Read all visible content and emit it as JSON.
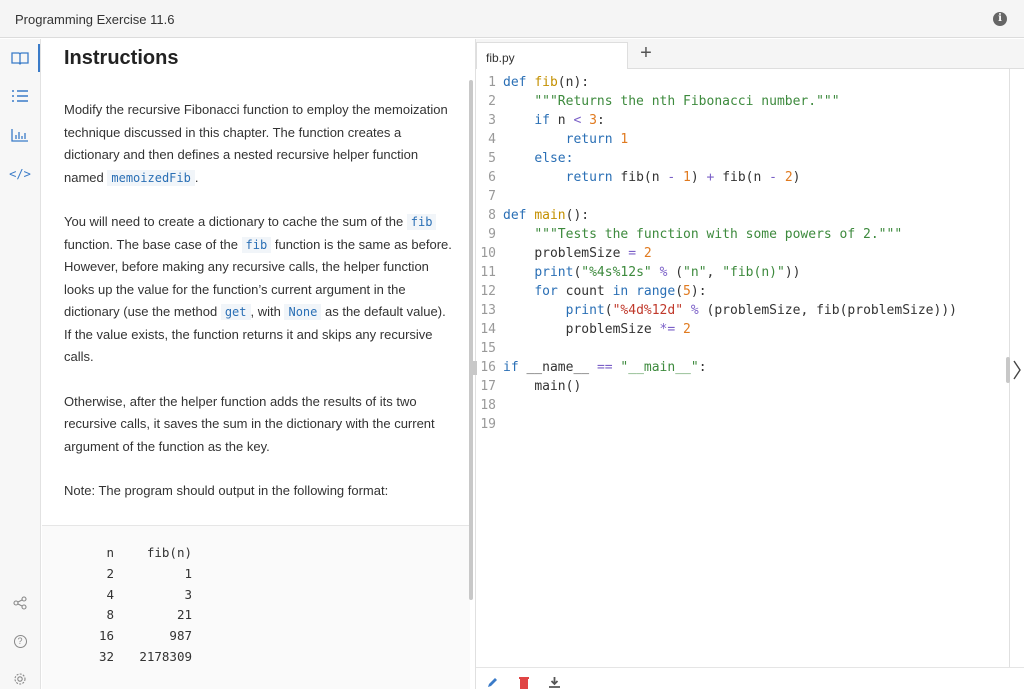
{
  "window": {
    "title": "Programming Exercise 11.6"
  },
  "rail": {
    "items": [
      {
        "name": "book-icon"
      },
      {
        "name": "list-icon"
      },
      {
        "name": "chart-icon"
      },
      {
        "name": "code-icon",
        "label": "</>"
      }
    ],
    "bottom_items": [
      {
        "name": "share-icon"
      },
      {
        "name": "help-icon",
        "label": "?"
      },
      {
        "name": "settings-icon"
      }
    ]
  },
  "instructions": {
    "heading": "Instructions",
    "para1": {
      "t1": "Modify the recursive Fibonacci function to employ the memoization technique discussed in this chapter. The function creates a dictionary and then defines a nested recursive helper function named ",
      "c1": "memoizedFib",
      "t2": "."
    },
    "para2": {
      "t1": "You will need to create a dictionary to cache the sum of the ",
      "c1": "fib",
      "t2": " function. The base case of the ",
      "c2": "fib",
      "t3": " function is the same as before. However, before making any recursive calls, the helper function looks up the value for the function’s current argument in the dictionary (use the method ",
      "c3": "get",
      "t4": ", with ",
      "c4": "None",
      "t5": " as the default value). If the value exists, the function returns it and skips any recursive calls."
    },
    "para3": "Otherwise, after the helper function adds the results of its two recursive calls, it saves the sum in the dictionary with the current argument of the function as the key.",
    "para4": "Note: The program should output in the following format:",
    "output": {
      "header": [
        "n",
        "fib(n)"
      ],
      "rows": [
        [
          "2",
          "1"
        ],
        [
          "4",
          "3"
        ],
        [
          "8",
          "21"
        ],
        [
          "16",
          "987"
        ],
        [
          "32",
          "2178309"
        ]
      ]
    }
  },
  "editor": {
    "tab_label": "fib.py",
    "add_tab_label": "+",
    "line_numbers": [
      "1",
      "2",
      "3",
      "4",
      "5",
      "6",
      "7",
      "8",
      "9",
      "10",
      "11",
      "12",
      "13",
      "14",
      "15",
      "16",
      "17",
      "18",
      "19"
    ],
    "code": {
      "l1": {
        "kw": "def",
        "fn": "fib",
        "rest": "(n):"
      },
      "l2": "\"\"\"Returns the nth Fibonacci number.\"\"\"",
      "l3": {
        "kw": "if",
        "a": "n",
        "op": "<",
        "num": "3",
        "end": ":"
      },
      "l4": {
        "kw": "return",
        "num": "1"
      },
      "l5": {
        "kw": "else",
        "end": ":"
      },
      "l6": {
        "kw": "return",
        "a": "fib(n",
        "op1": "-",
        "n1": "1",
        "b": ")",
        "op2": "+",
        "c": "fib(n",
        "op3": "-",
        "n2": "2",
        "d": ")"
      },
      "l8": {
        "kw": "def",
        "fn": "main",
        "rest": "():"
      },
      "l9": "\"\"\"Tests the function with some powers of 2.\"\"\"",
      "l10": {
        "a": "problemSize",
        "op": "=",
        "num": "2"
      },
      "l11": {
        "kw": "print",
        "p1": "(",
        "str": "\"%4s%12s\"",
        "op": "%",
        "p2": "(",
        "s1": "\"n\"",
        "comma": ", ",
        "s2": "\"fib(n)\"",
        "end": "))"
      },
      "l12": {
        "kw1": "for",
        "a": "count",
        "kw2": "in",
        "kw3": "range",
        "p1": "(",
        "num": "5",
        "end": "):"
      },
      "l13": {
        "kw": "print",
        "p1": "(",
        "str": "\"%4d%12d\"",
        "op": "%",
        "rest": "(problemSize, fib(problemSize)))"
      },
      "l14": {
        "a": "problemSize",
        "op": "*=",
        "num": "2"
      },
      "l16": {
        "kw": "if",
        "a": "__name__",
        "op": "==",
        "str": "\"__main__\"",
        "end": ":"
      },
      "l17": "main()"
    }
  },
  "colors": {
    "accent": "#3a7bc8",
    "keyword": "#2a6fb5",
    "function": "#c49000",
    "string": "#3d8a3d",
    "number": "#e07a1f",
    "operator": "#7a5fc7",
    "delete": "#e04545"
  },
  "toolbar": {
    "items": [
      "pencil-icon",
      "trash-icon",
      "download-icon"
    ]
  }
}
